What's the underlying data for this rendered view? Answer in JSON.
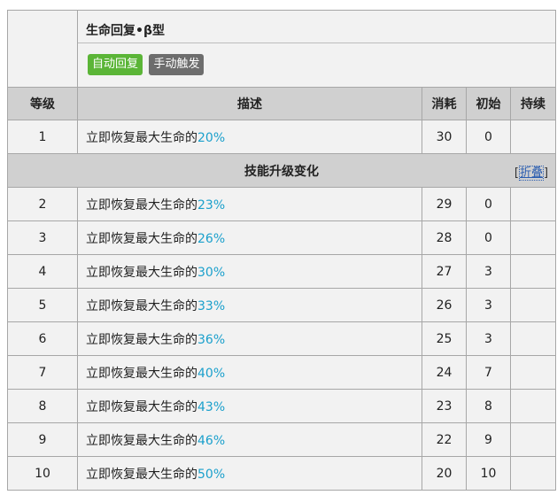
{
  "skill": {
    "name": "生命回复•β型",
    "tags": [
      "自动回复",
      "手动触发"
    ],
    "colors": {
      "tag_auto": "#5bb537",
      "tag_manual": "#6d6d6d",
      "percent": "#1ba0cc",
      "header_bg": "#d0d0d0"
    }
  },
  "headers": {
    "level": "等级",
    "desc": "描述",
    "cost": "消耗",
    "initial": "初始",
    "duration": "持续"
  },
  "desc_prefix": "立即恢复最大生命的",
  "upgrade": {
    "label": "技能升级变化",
    "toggle_open": "[",
    "toggle_label": "折叠",
    "toggle_close": "]"
  },
  "rows": [
    {
      "level": "1",
      "pct": "20%",
      "cost": "30",
      "initial": "0",
      "duration": ""
    },
    {
      "level": "2",
      "pct": "23%",
      "cost": "29",
      "initial": "0",
      "duration": ""
    },
    {
      "level": "3",
      "pct": "26%",
      "cost": "28",
      "initial": "0",
      "duration": ""
    },
    {
      "level": "4",
      "pct": "30%",
      "cost": "27",
      "initial": "3",
      "duration": ""
    },
    {
      "level": "5",
      "pct": "33%",
      "cost": "26",
      "initial": "3",
      "duration": ""
    },
    {
      "level": "6",
      "pct": "36%",
      "cost": "25",
      "initial": "3",
      "duration": ""
    },
    {
      "level": "7",
      "pct": "40%",
      "cost": "24",
      "initial": "7",
      "duration": ""
    },
    {
      "level": "8",
      "pct": "43%",
      "cost": "23",
      "initial": "8",
      "duration": ""
    },
    {
      "level": "9",
      "pct": "46%",
      "cost": "22",
      "initial": "9",
      "duration": ""
    },
    {
      "level": "10",
      "pct": "50%",
      "cost": "20",
      "initial": "10",
      "duration": ""
    }
  ]
}
